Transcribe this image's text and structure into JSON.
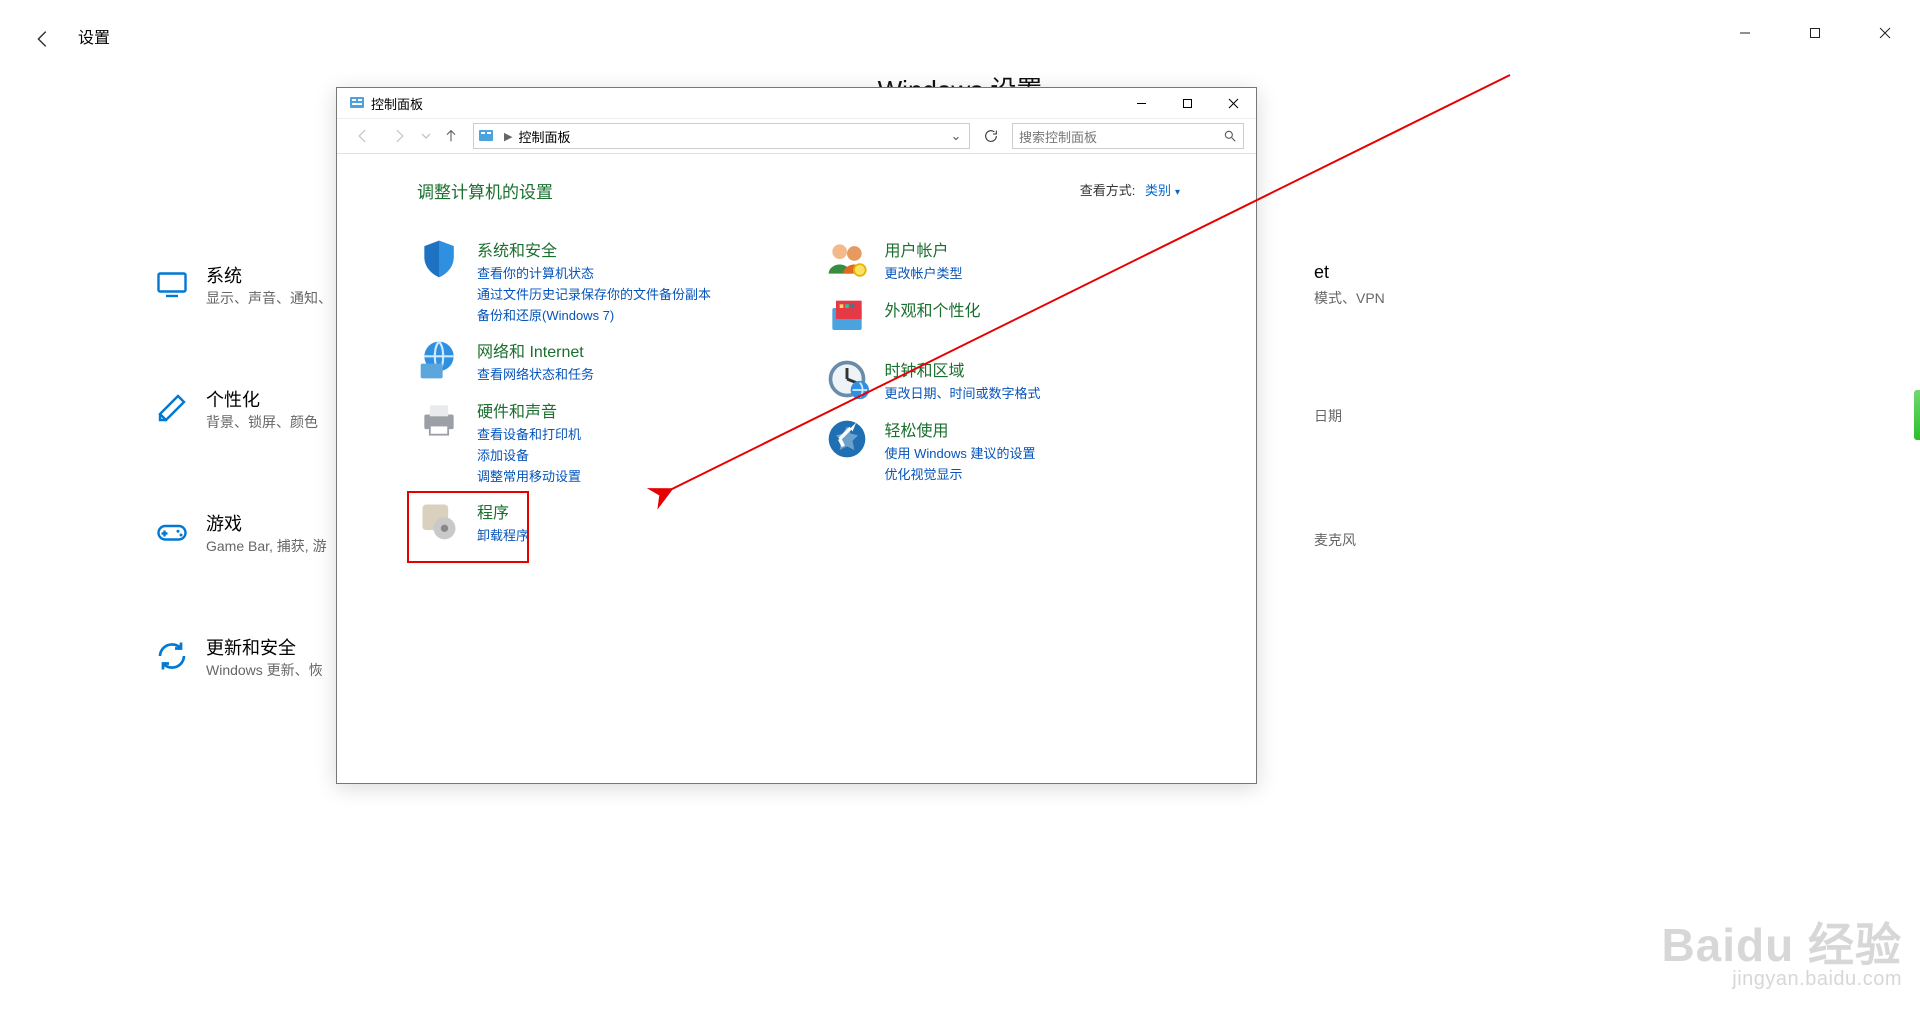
{
  "settings": {
    "title": "设置",
    "heading": "Windows 设置",
    "categories": {
      "system": {
        "title": "系统",
        "desc": "显示、声音、通知、"
      },
      "personal": {
        "title": "个性化",
        "desc": "背景、锁屏、颜色"
      },
      "gaming": {
        "title": "游戏",
        "desc": "Game Bar, 捕获, 游"
      },
      "update": {
        "title": "更新和安全",
        "desc": "Windows 更新、恢"
      },
      "network_frag": {
        "desc_tail": "et",
        "desc_tail2": "模式、VPN"
      },
      "time_frag": {
        "desc_tail": "日期"
      },
      "privacy_frag": {
        "desc_tail": "麦克风"
      }
    }
  },
  "controlPanel": {
    "windowTitle": "控制面板",
    "breadcrumb": "控制面板",
    "searchPlaceholder": "搜索控制面板",
    "heading": "调整计算机的设置",
    "viewBy": {
      "label": "查看方式:",
      "value": "类别"
    },
    "left": {
      "systemSecurity": {
        "title": "系统和安全",
        "links": [
          "查看你的计算机状态",
          "通过文件历史记录保存你的文件备份副本",
          "备份和还原(Windows 7)"
        ]
      },
      "network": {
        "title": "网络和 Internet",
        "links": [
          "查看网络状态和任务"
        ]
      },
      "hardware": {
        "title": "硬件和声音",
        "links": [
          "查看设备和打印机",
          "添加设备",
          "调整常用移动设置"
        ]
      },
      "programs": {
        "title": "程序",
        "links": [
          "卸载程序"
        ]
      }
    },
    "right": {
      "users": {
        "title": "用户帐户",
        "links": [
          "更改帐户类型"
        ]
      },
      "appearance": {
        "title": "外观和个性化",
        "links": []
      },
      "clock": {
        "title": "时钟和区域",
        "links": [
          "更改日期、时间或数字格式"
        ]
      },
      "ease": {
        "title": "轻松使用",
        "links": [
          "使用 Windows 建议的设置",
          "优化视觉显示"
        ]
      }
    }
  },
  "watermark": {
    "line1": "Baidu 经验",
    "line2": "jingyan.baidu.com"
  }
}
